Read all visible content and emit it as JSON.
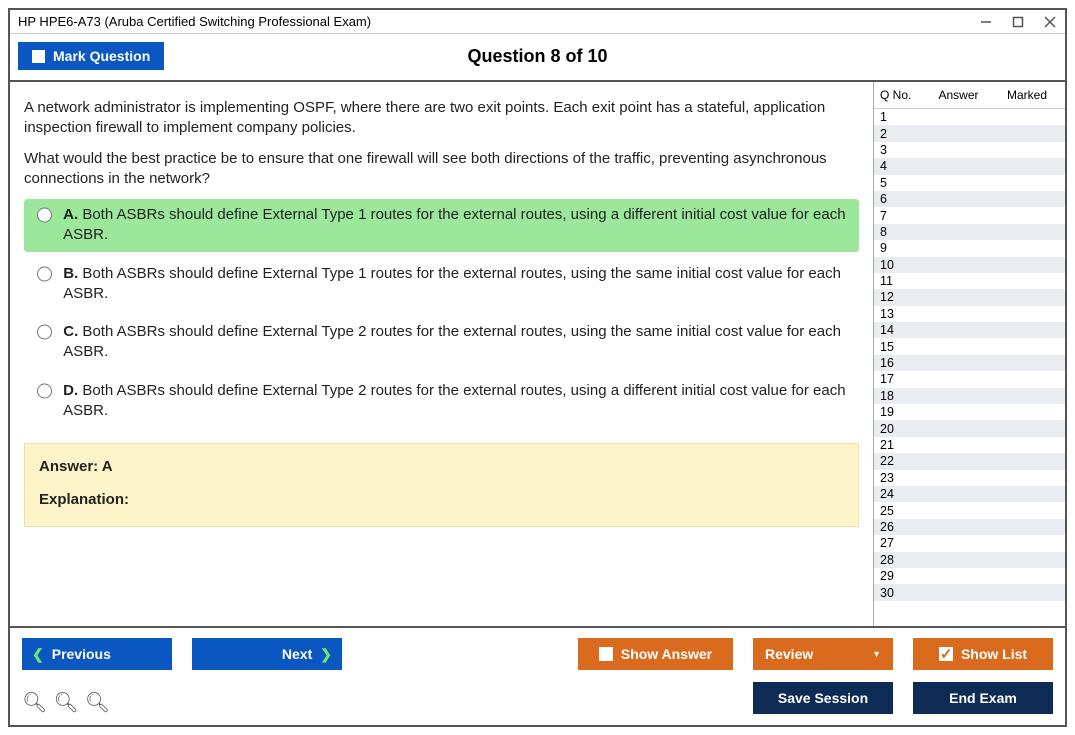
{
  "window": {
    "title": "HP HPE6-A73 (Aruba Certified Switching Professional Exam)"
  },
  "topbar": {
    "mark_label": "Mark Question",
    "counter": "Question 8 of 10"
  },
  "question": {
    "para1": "A network administrator is implementing OSPF, where there are two exit points. Each exit point has a stateful, application inspection firewall to implement company policies.",
    "para2": "What would the best practice be to ensure that one firewall will see both directions of the traffic, preventing asynchronous connections in the network?"
  },
  "options": {
    "a": {
      "letter": "A.",
      "text": " Both ASBRs should define External Type 1 routes for the external routes, using a different initial cost value for each ASBR."
    },
    "b": {
      "letter": "B.",
      "text": " Both ASBRs should define External Type 1 routes for the external routes, using the same initial cost value for each ASBR."
    },
    "c": {
      "letter": "C.",
      "text": " Both ASBRs should define External Type 2 routes for the external routes, using the same initial cost value for each ASBR."
    },
    "d": {
      "letter": "D.",
      "text": " Both ASBRs should define External Type 2 routes for the external routes, using a different initial cost value for each ASBR."
    }
  },
  "answer": {
    "line": "Answer: A",
    "exp": "Explanation:"
  },
  "sidebar": {
    "h1": "Q No.",
    "h2": "Answer",
    "h3": "Marked",
    "rows": [
      "1",
      "2",
      "3",
      "4",
      "5",
      "6",
      "7",
      "8",
      "9",
      "10",
      "11",
      "12",
      "13",
      "14",
      "15",
      "16",
      "17",
      "18",
      "19",
      "20",
      "21",
      "22",
      "23",
      "24",
      "25",
      "26",
      "27",
      "28",
      "29",
      "30"
    ]
  },
  "buttons": {
    "previous": "Previous",
    "next": "Next",
    "show_answer": "Show Answer",
    "review": "Review",
    "show_list": "Show List",
    "save_session": "Save Session",
    "end_exam": "End Exam"
  }
}
